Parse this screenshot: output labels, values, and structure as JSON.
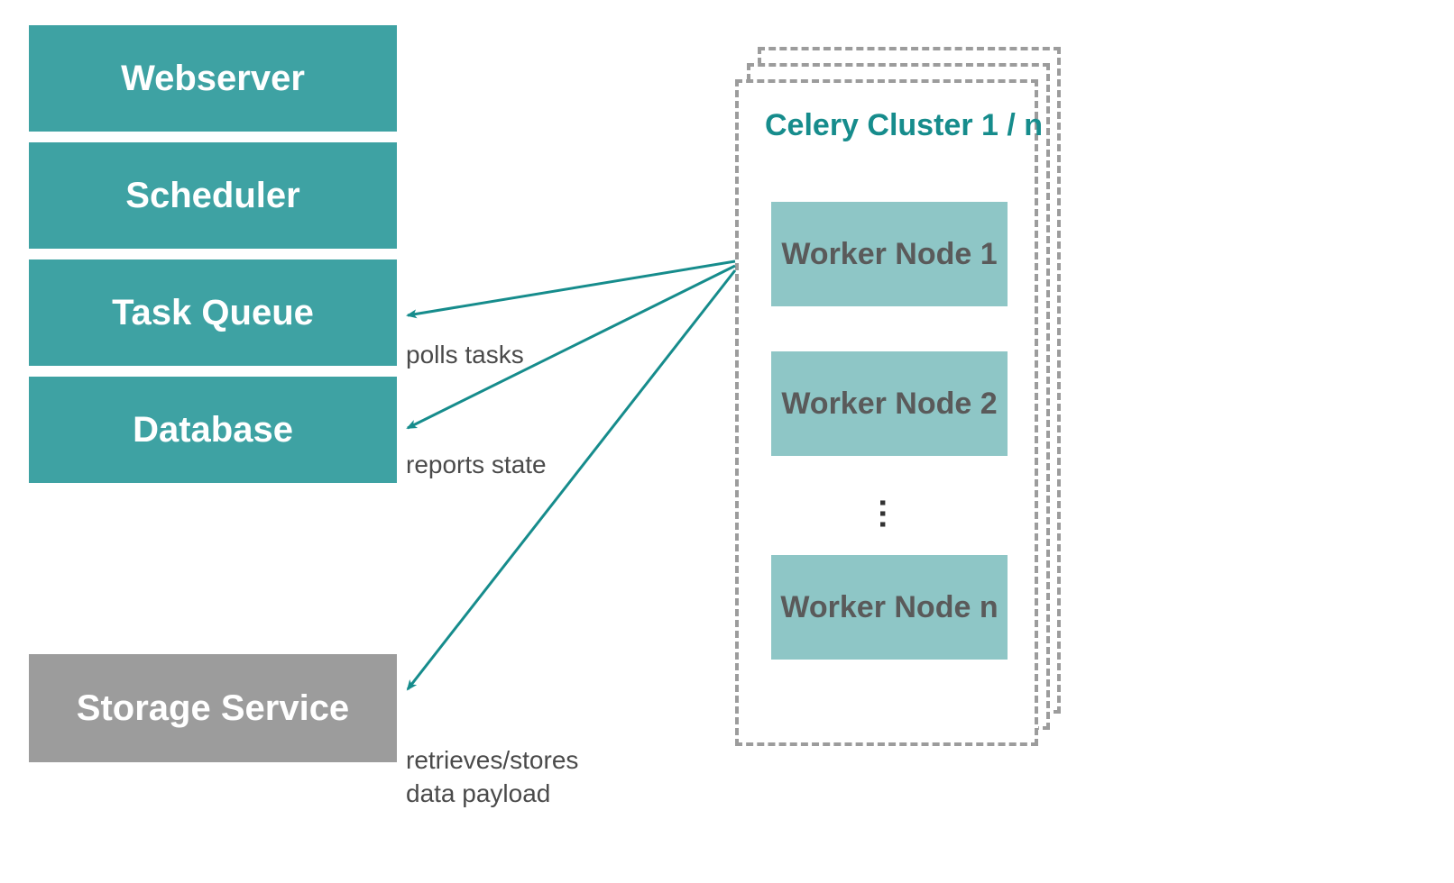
{
  "left_stack": {
    "webserver": "Webserver",
    "scheduler": "Scheduler",
    "task_queue": "Task Queue",
    "database": "Database"
  },
  "storage": "Storage Service",
  "cluster": {
    "title": "Celery Cluster 1 / n",
    "worker1": "Worker Node 1",
    "worker2": "Worker Node 2",
    "ellipsis": "...",
    "workern": "Worker Node n"
  },
  "arrows": {
    "polls": "polls tasks",
    "reports": "reports state",
    "retrieve": "retrieves/stores\ndata payload"
  }
}
